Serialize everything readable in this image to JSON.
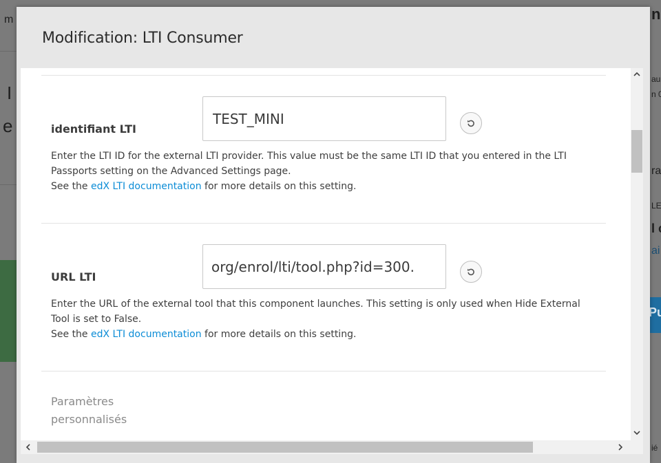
{
  "background": {
    "fragments": [
      "m",
      "n",
      "I",
      "e",
      "au",
      "n 0",
      "ra",
      "LE",
      "l c",
      "ai",
      "Pu",
      "ié"
    ]
  },
  "modal": {
    "title": "Modification: LTI Consumer",
    "settings": [
      {
        "label": "identifiant LTI",
        "value": "TEST_MINI",
        "help_text": "Enter the LTI ID for the external LTI provider. This value must be the same LTI ID that you entered in the LTI Passports setting on the Advanced Settings page.",
        "see_prefix": "See the ",
        "link_text": "edX LTI documentation",
        "see_suffix": " for more details on this setting."
      },
      {
        "label": "URL LTI",
        "value": ".org/enrol/lti/tool.php?id=300",
        "help_text": "Enter the URL of the external tool that this component launches. This setting is only used when Hide External Tool is set to False.",
        "see_prefix": "See the ",
        "link_text": "edX LTI documentation",
        "see_suffix": " for more details on this setting."
      }
    ],
    "partial_setting_label": "Paramètres personnalisés"
  },
  "icons": {
    "reset": "reset-icon",
    "scroll_up": "chevron-up-icon",
    "scroll_down": "chevron-down-icon",
    "scroll_left": "chevron-left-icon",
    "scroll_right": "chevron-right-icon"
  },
  "colors": {
    "link": "#0b8cd6",
    "modal_header": "#e7e7e7",
    "overlay": "#7b7b7b"
  }
}
